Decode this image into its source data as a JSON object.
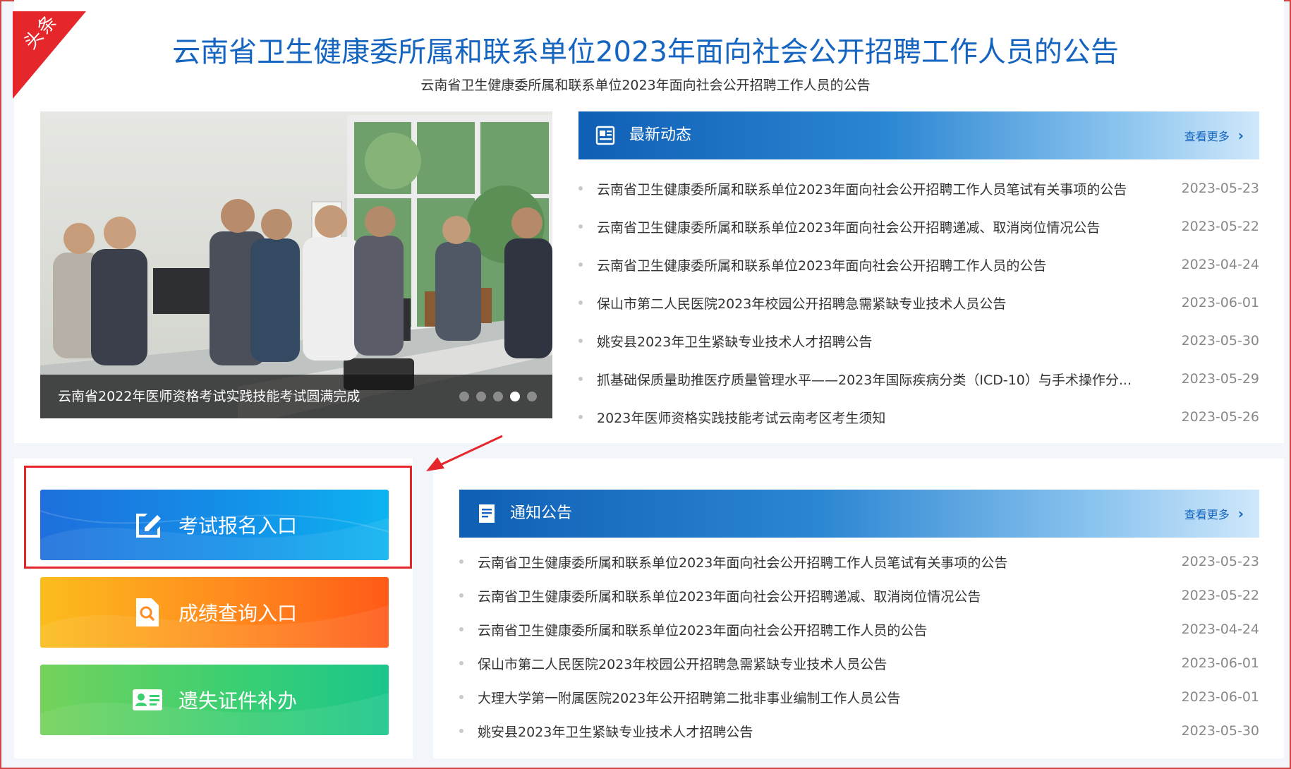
{
  "ribbon": {
    "label": "头条"
  },
  "headline": {
    "title": "云南省卫生健康委所属和联系单位2023年面向社会公开招聘工作人员的公告",
    "subtitle": "云南省卫生健康委所属和联系单位2023年面向社会公开招聘工作人员的公告"
  },
  "carousel": {
    "caption": "云南省2022年医师资格考试实践技能考试圆满完成",
    "slide_count": 5,
    "active_index": 3
  },
  "latest_news": {
    "title": "最新动态",
    "more_label": "查看更多",
    "items": [
      {
        "title": "云南省卫生健康委所属和联系单位2023年面向社会公开招聘工作人员笔试有关事项的公告",
        "date": "2023-05-23"
      },
      {
        "title": "云南省卫生健康委所属和联系单位2023年面向社会公开招聘递减、取消岗位情况公告",
        "date": "2023-05-22"
      },
      {
        "title": "云南省卫生健康委所属和联系单位2023年面向社会公开招聘工作人员的公告",
        "date": "2023-04-24"
      },
      {
        "title": "保山市第二人民医院2023年校园公开招聘急需紧缺专业技术人员公告",
        "date": "2023-06-01"
      },
      {
        "title": "姚安县2023年卫生紧缺专业技术人才招聘公告",
        "date": "2023-05-30"
      },
      {
        "title": "抓基础保质量助推医疗质量管理水平——2023年国际疾病分类（ICD-10）与手术操作分...",
        "date": "2023-05-29"
      },
      {
        "title": "2023年医师资格实践技能考试云南考区考生须知",
        "date": "2023-05-26"
      }
    ]
  },
  "entry_buttons": {
    "register": "考试报名入口",
    "score": "成绩查询入口",
    "lost_certificate": "遗失证件补办"
  },
  "notices": {
    "title": "通知公告",
    "more_label": "查看更多",
    "items": [
      {
        "title": "云南省卫生健康委所属和联系单位2023年面向社会公开招聘工作人员笔试有关事项的公告",
        "date": "2023-05-23"
      },
      {
        "title": "云南省卫生健康委所属和联系单位2023年面向社会公开招聘递减、取消岗位情况公告",
        "date": "2023-05-22"
      },
      {
        "title": "云南省卫生健康委所属和联系单位2023年面向社会公开招聘工作人员的公告",
        "date": "2023-04-24"
      },
      {
        "title": "保山市第二人民医院2023年校园公开招聘急需紧缺专业技术人员公告",
        "date": "2023-06-01"
      },
      {
        "title": "大理大学第一附属医院2023年公开招聘第二批非事业编制工作人员公告",
        "date": "2023-06-01"
      },
      {
        "title": "姚安县2023年卫生紧缺专业技术人才招聘公告",
        "date": "2023-05-30"
      }
    ]
  },
  "colors": {
    "brand_blue": "#1565c0",
    "highlight_red": "#e5262b",
    "ribbon_red": "#e5262b"
  }
}
